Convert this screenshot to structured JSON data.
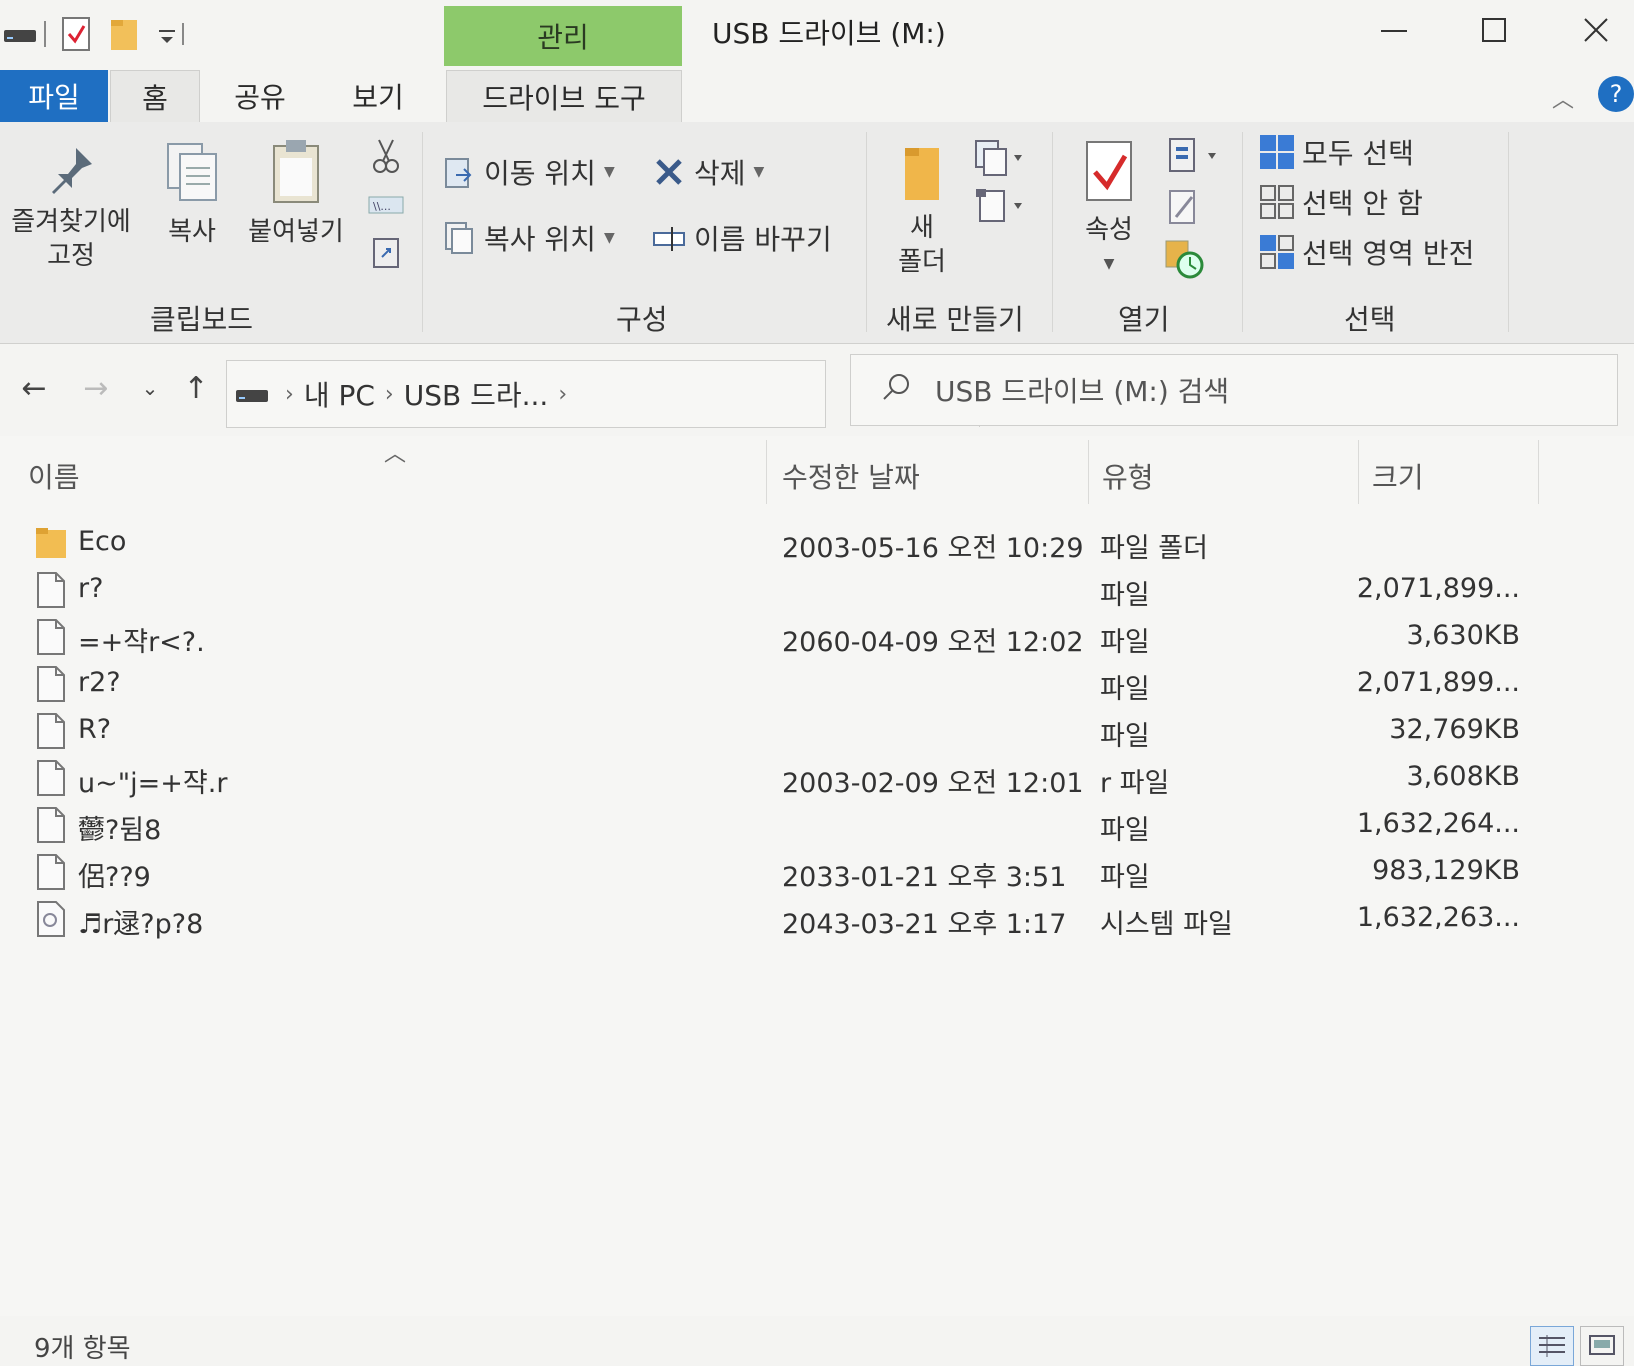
{
  "window": {
    "title": "USB 드라이브 (M:)",
    "manage_tab": "관리",
    "accent": "#1f6fc2",
    "manage_color": "#8dc96b"
  },
  "tabs": {
    "file": "파일",
    "home": "홈",
    "share": "공유",
    "view": "보기",
    "drive_tools": "드라이브 도구"
  },
  "ribbon": {
    "clipboard": {
      "label": "클립보드",
      "pin_line1": "즐겨찾기에",
      "pin_line2": "고정",
      "copy": "복사",
      "paste": "붙여넣기"
    },
    "organize": {
      "label": "구성",
      "move_to": "이동 위치",
      "copy_to": "복사 위치",
      "delete": "삭제",
      "rename": "이름 바꾸기"
    },
    "new": {
      "label": "새로 만들기",
      "folder_line1": "새",
      "folder_line2": "폴더"
    },
    "open": {
      "label": "열기",
      "properties": "속성"
    },
    "select": {
      "label": "선택",
      "select_all": "모두 선택",
      "select_none": "선택 안 함",
      "invert": "선택 영역 반전"
    }
  },
  "address": {
    "crumb_pc": "내 PC",
    "crumb_drive": "USB 드라...",
    "search_placeholder": "USB 드라이브 (M:) 검색"
  },
  "columns": {
    "name": "이름",
    "date": "수정한 날짜",
    "type": "유형",
    "size": "크기"
  },
  "files": [
    {
      "icon": "folder-icon",
      "name": "Eco",
      "date": "2003-05-16 오전 10:29",
      "type": "파일 폴더",
      "size": ""
    },
    {
      "icon": "file-icon",
      "name": "r?",
      "date": "",
      "type": "파일",
      "size": "2,071,899..."
    },
    {
      "icon": "file-icon",
      "name": "=+쟉r<?.",
      "date": "2060-04-09 오전 12:02",
      "type": "파일",
      "size": "3,630KB"
    },
    {
      "icon": "file-icon",
      "name": "r2?",
      "date": "",
      "type": "파일",
      "size": "2,071,899..."
    },
    {
      "icon": "file-icon",
      "name": "R?",
      "date": "",
      "type": "파일",
      "size": "32,769KB"
    },
    {
      "icon": "file-icon",
      "name": "u~\"j=+쟉.r",
      "date": "2003-02-09 오전 12:01",
      "type": "r 파일",
      "size": "3,608KB"
    },
    {
      "icon": "file-icon",
      "name": "䖇?뒴8",
      "date": "",
      "type": "파일",
      "size": "1,632,264..."
    },
    {
      "icon": "file-icon",
      "name": "侶??9",
      "date": "2033-01-21 오후 3:51",
      "type": "파일",
      "size": "983,129KB"
    },
    {
      "icon": "system-file-icon",
      "name": "♬r逯?p?8",
      "date": "2043-03-21 오후 1:17",
      "type": "시스템 파일",
      "size": "1,632,263..."
    }
  ],
  "status": {
    "item_count": "9개 항목"
  }
}
